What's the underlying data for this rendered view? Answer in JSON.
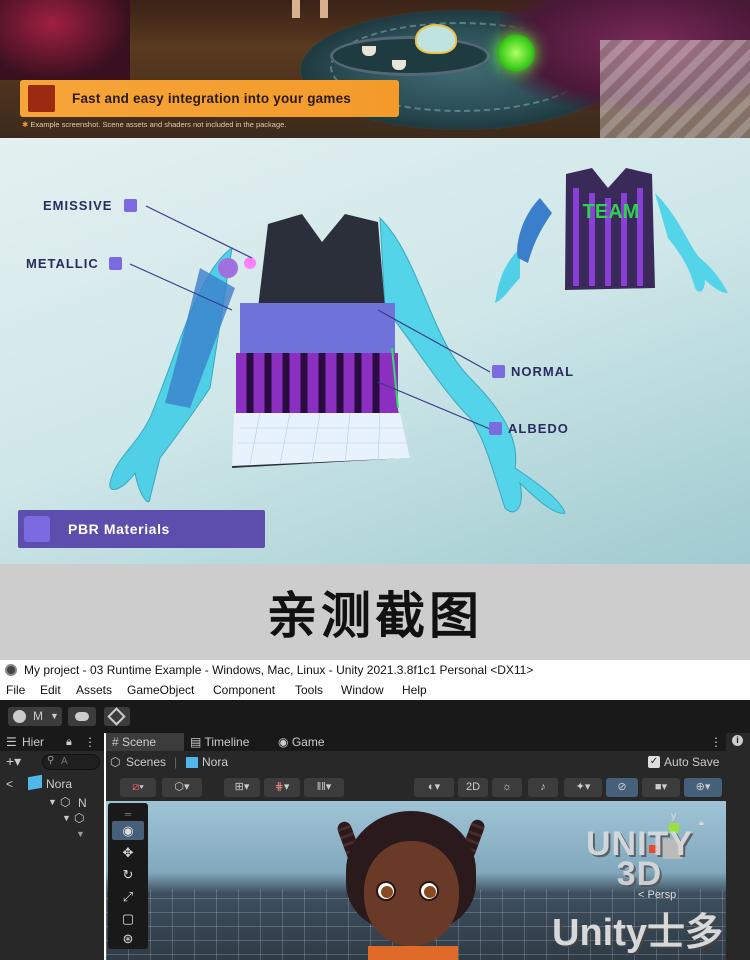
{
  "banner": {
    "title": "Fast and easy integration into your games",
    "note_star": "✱",
    "note": "Example screenshot. Scene assets and shaders not included in the package."
  },
  "pbr": {
    "labels": {
      "emissive": "EMISSIVE",
      "metallic": "METALLIC",
      "normal": "NORMAL",
      "albedo": "ALBEDO"
    },
    "jersey_text": "TEAM",
    "bar_label": "PBR Materials"
  },
  "caption": "亲测截图",
  "unity": {
    "window_title": "My project - 03 Runtime Example - Windows, Mac, Linux - Unity 2021.3.8f1c1 Personal <DX11>",
    "menu": [
      "File",
      "Edit",
      "Assets",
      "GameObject",
      "Component",
      "Tools",
      "Window",
      "Help"
    ],
    "account_label": "M",
    "hierarchy": {
      "tab": "Hier",
      "search_placeholder": "A",
      "root": "Nora",
      "child": "N"
    },
    "scene_tabs": {
      "scene": "Scene",
      "timeline": "Timeline",
      "game": "Game"
    },
    "breadcrumbs": {
      "scenes": "Scenes",
      "object": "Nora"
    },
    "auto_save": "Auto Save",
    "auto_save_checked": true,
    "scene_tools": {
      "mode_2d": "2D"
    },
    "viewport": {
      "persp_label": "< Persp",
      "gizmo_axis": "y"
    }
  },
  "watermark": {
    "line1": "UNITY",
    "line2": "3D",
    "brand": "Unity士多"
  },
  "colors": {
    "banner_accent": "#f6a53a",
    "pbr_accent": "#7b6ae0",
    "pbr_bar": "#5d4dad",
    "pbr_label": "#2b2c5e",
    "editor_bg": "#282828"
  }
}
